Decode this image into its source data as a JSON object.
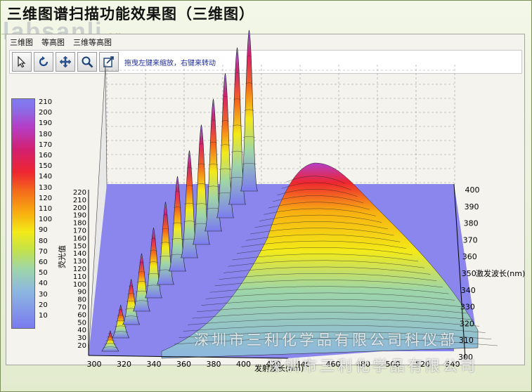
{
  "page_title": "三维图谱扫描功能效果图（三维图）",
  "watermark_top": "labsanli",
  "watermark_top_suffix": ".cn",
  "watermark_bottom_1": "深圳市三利化学品有限公司科仪部",
  "watermark_bottom_2": "深圳市三利化学品有限公司",
  "tabs": [
    "三维图",
    "等高图",
    "三维等高图"
  ],
  "toolbar": {
    "tools": [
      {
        "name": "pointer-icon",
        "label": "select"
      },
      {
        "name": "rotate-icon",
        "label": "rotate"
      },
      {
        "name": "move-icon",
        "label": "pan"
      },
      {
        "name": "zoom-icon",
        "label": "zoom"
      },
      {
        "name": "export-icon",
        "label": "export"
      }
    ],
    "hint": "拖曳左键来缩放，右键来转动"
  },
  "colorbar": {
    "ticks": [
      "210",
      "200",
      "190",
      "180",
      "170",
      "160",
      "150",
      "140",
      "130",
      "120",
      "110",
      "100",
      "90",
      "80",
      "70",
      "60",
      "50",
      "40",
      "30",
      "20",
      "10"
    ]
  },
  "chart_data": {
    "type": "surface",
    "x_axis_label": "发射波长(nm)",
    "y_axis_label": "荧光值",
    "z_axis_label": "激发波长(nm)",
    "x_ticks": [
      "300",
      "320",
      "340",
      "360",
      "380",
      "400",
      "420",
      "440",
      "460",
      "480",
      "500",
      "520",
      "540"
    ],
    "y_ticks": [
      "220",
      "210",
      "200",
      "190",
      "180",
      "170",
      "160",
      "150",
      "140",
      "130",
      "120",
      "110",
      "100",
      "90",
      "80",
      "70",
      "60",
      "50",
      "40",
      "30",
      "20"
    ],
    "z_ticks": [
      "400",
      "390",
      "380",
      "370",
      "360",
      "350",
      "340",
      "330",
      "320",
      "310",
      "300"
    ],
    "x_range": [
      300,
      540
    ],
    "y_range": [
      20,
      220
    ],
    "z_range": [
      300,
      400
    ],
    "rayleigh_peaks": {
      "emission": [
        307,
        314,
        321,
        328,
        336,
        344,
        352,
        360,
        368,
        376,
        384,
        392,
        400
      ],
      "intensity": [
        45,
        60,
        75,
        90,
        105,
        120,
        135,
        150,
        165,
        180,
        195,
        210,
        215
      ]
    },
    "main_peak": {
      "emission": 440,
      "excitation": 370,
      "intensity": 148
    },
    "colors": {
      "low": "#7b7bf0",
      "mid": "#f3ea18",
      "high": "#d22070",
      "top": "#7f7cf2"
    }
  }
}
